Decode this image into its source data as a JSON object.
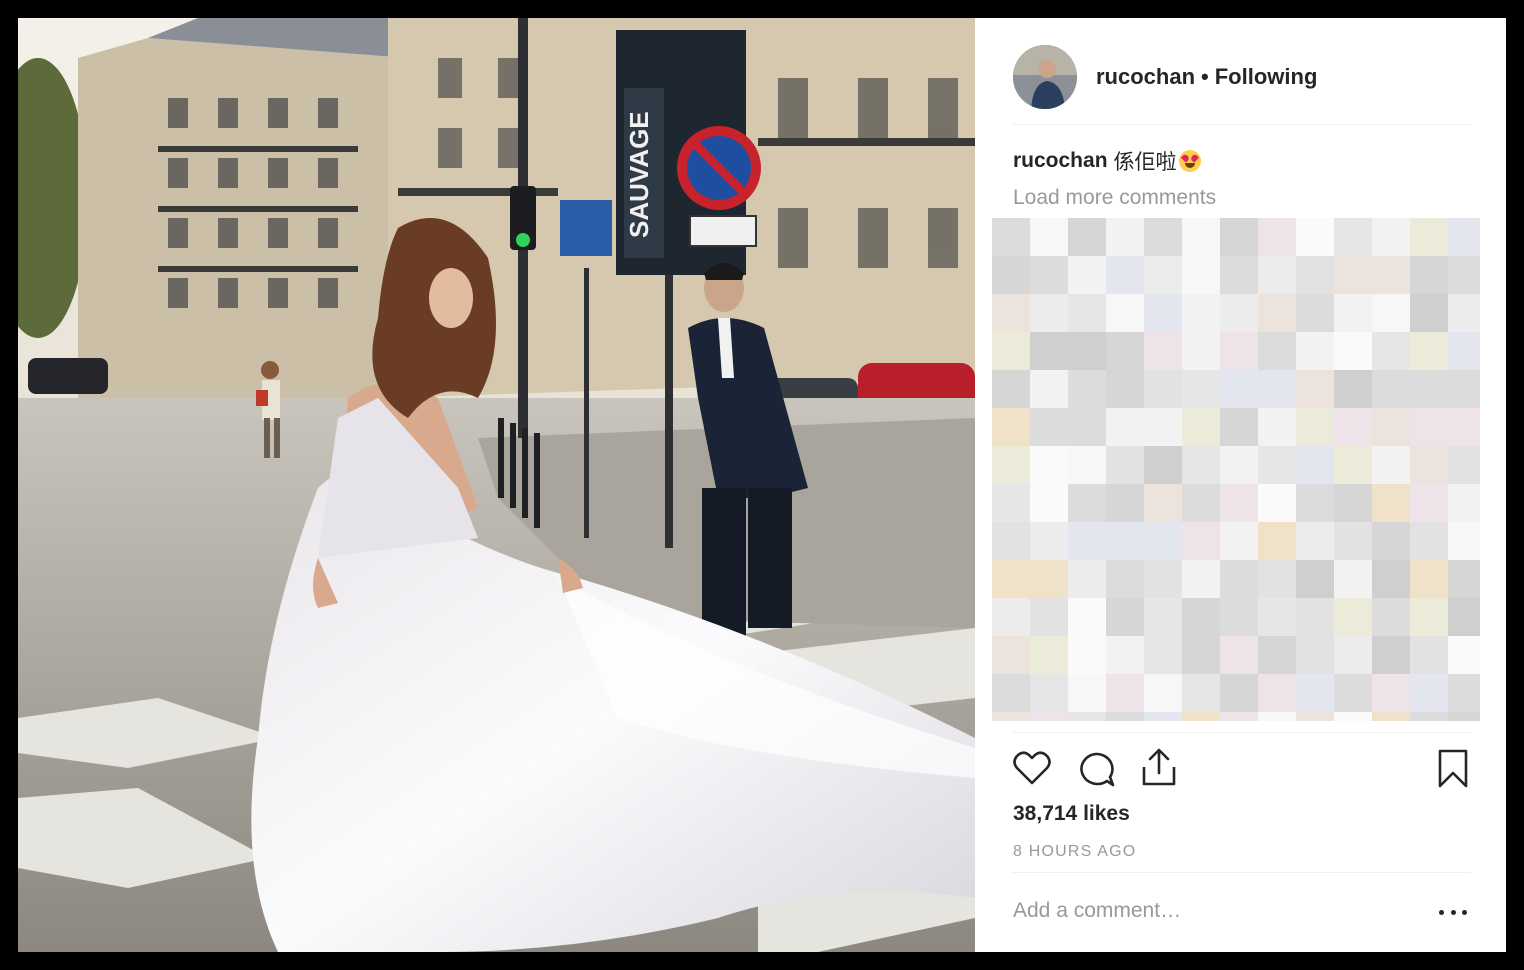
{
  "post": {
    "username": "rucochan",
    "separator": "•",
    "follow_status": "Following",
    "caption_user": "rucochan",
    "caption_text": "係佢啦",
    "caption_emoji": "heart-eyes-emoji",
    "load_more_label": "Load more comments",
    "likes": "38,714 likes",
    "time_ago": "8 HOURS AGO",
    "comment_placeholder": "Add a comment…"
  },
  "photo": {
    "street_sign_text": "SAUVAGE"
  },
  "icons": {
    "like": "heart-icon",
    "comment": "speech-bubble-icon",
    "share": "share-icon",
    "save": "bookmark-icon",
    "options": "more-options-icon"
  },
  "colors": {
    "text": "#262626",
    "muted": "#999999",
    "divider": "#efefef",
    "emoji_face": "#ffcc4d",
    "emoji_heart": "#e0245e"
  }
}
